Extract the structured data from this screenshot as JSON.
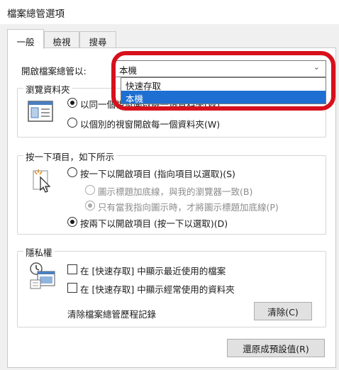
{
  "window": {
    "title": "檔案總管選項"
  },
  "tabs": [
    {
      "label": "一般",
      "active": true
    },
    {
      "label": "檢視",
      "active": false
    },
    {
      "label": "搜尋",
      "active": false
    }
  ],
  "open_with": {
    "label": "開啟檔案總管以:",
    "selected": "本機",
    "options": [
      "快速存取",
      "本機"
    ]
  },
  "browse_folders": {
    "legend": "瀏覽資料夾",
    "option_same": "以同一個視窗開啟每一個資料夾(W)",
    "option_separate": "以個別的視窗開啟每一個資料夾(W)"
  },
  "click_items": {
    "legend": "按一下項目，如下所示",
    "single_click": "按一下以開啟項目 (指向項目以選取)(S)",
    "underline_consistent": "圖示標題加底線，與我的瀏覽器一致(B)",
    "underline_on_point": "只有當我指向圖示時，才將圖示標題加底線(P)",
    "double_click": "按兩下以開啟項目 (按一下以選取)(D)"
  },
  "privacy": {
    "legend": "隱私權",
    "recent_files": "在 [快速存取] 中顯示最近使用的檔案",
    "frequent_folders": "在 [快速存取] 中顯示經常使用的資料夾",
    "clear_history_label": "清除檔案總管歷程記錄",
    "clear_button": "清除(C)"
  },
  "restore_defaults_button": "還原成預設值(R)",
  "colors": {
    "highlight": "#d6101c",
    "selection": "#1e6fd1"
  }
}
